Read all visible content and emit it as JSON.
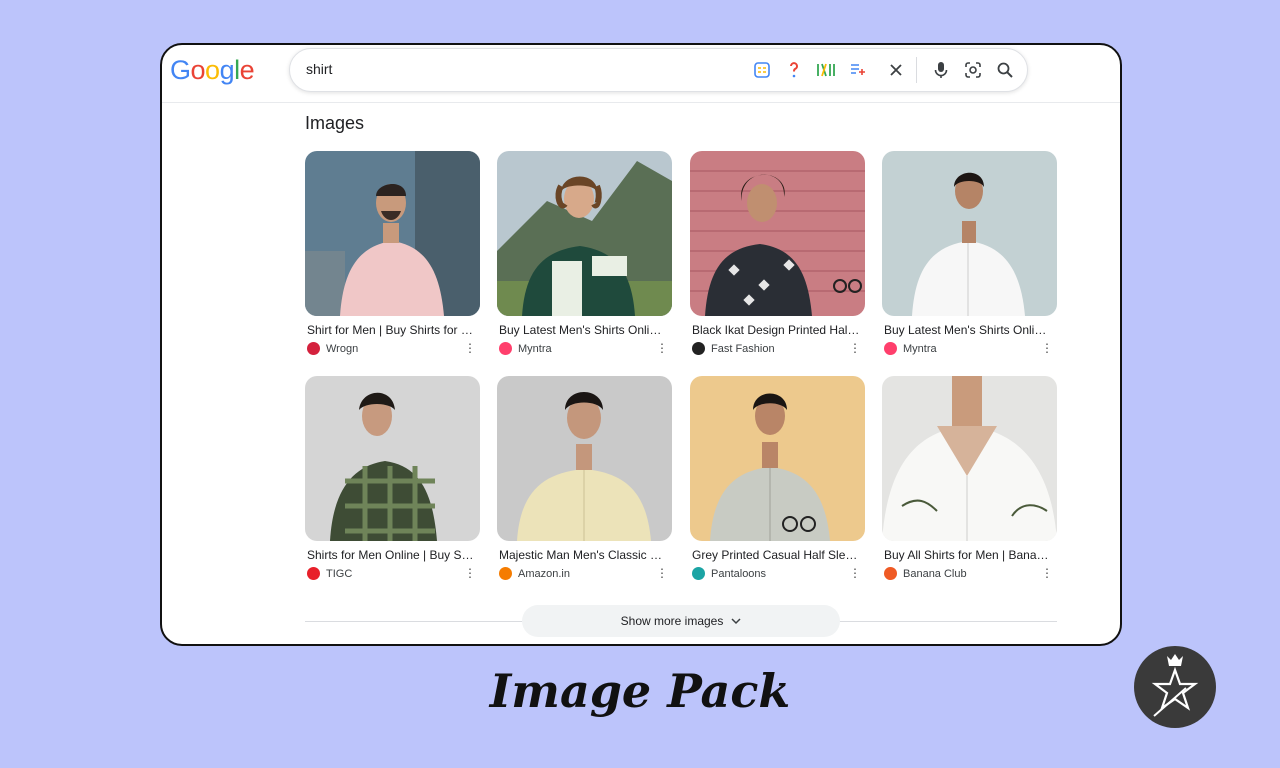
{
  "brand": {
    "logo_letters": [
      "G",
      "o",
      "o",
      "g",
      "l",
      "e"
    ],
    "logo_colors": [
      "#4285F4",
      "#EA4335",
      "#FBBC05",
      "#4285F4",
      "#34A853",
      "#EA4335"
    ]
  },
  "search": {
    "query": "shirt"
  },
  "section_title": "Images",
  "results": [
    {
      "caption": "Shirt for Men | Buy Shirts for …",
      "source": "Wrogn",
      "favicon_color": "#d4213d"
    },
    {
      "caption": "Buy Latest Men's Shirts Onlin…",
      "source": "Myntra",
      "favicon_color": "#ff3f6c"
    },
    {
      "caption": "Black Ikat Design Printed Half…",
      "source": "Fast Fashion",
      "favicon_color": "#222222"
    },
    {
      "caption": "Buy Latest Men's Shirts Onlin…",
      "source": "Myntra",
      "favicon_color": "#ff3f6c"
    },
    {
      "caption": "Shirts for Men Online | Buy S…",
      "source": "TIGC",
      "favicon_color": "#e8202a"
    },
    {
      "caption": "Majestic Man Men's Classic S…",
      "source": "Amazon.in",
      "favicon_color": "#f57c00"
    },
    {
      "caption": "Grey Printed Casual Half Sle…",
      "source": "Pantaloons",
      "favicon_color": "#1ba4a4"
    },
    {
      "caption": "Buy All Shirts for Men | Banan…",
      "source": "Banana Club",
      "favicon_color": "#ef5a24"
    }
  ],
  "show_more": {
    "label": "Show more images"
  },
  "page_caption": "Image Pack"
}
